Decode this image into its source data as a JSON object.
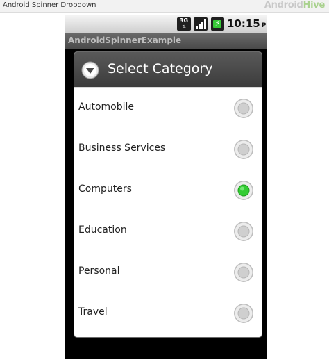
{
  "caption": {
    "title": "Android Spinner Dropdown",
    "watermark_part1": "Android",
    "watermark_part2": "Hive"
  },
  "status_bar": {
    "network_badge": "3G",
    "time": "10:15",
    "meridiem": "PM"
  },
  "app": {
    "title": "AndroidSpinnerExample"
  },
  "dialog": {
    "title": "Select Category",
    "header_icon": "dropdown-circle-icon",
    "options": [
      {
        "label": "Automobile",
        "selected": false
      },
      {
        "label": "Business Services",
        "selected": false
      },
      {
        "label": "Computers",
        "selected": true
      },
      {
        "label": "Education",
        "selected": false
      },
      {
        "label": "Personal",
        "selected": false
      },
      {
        "label": "Travel",
        "selected": false
      }
    ]
  },
  "colors": {
    "selected_radio": "#33cc33",
    "unselected_radio": "#cfcfcf",
    "header_bg": "#4a4a4a"
  }
}
